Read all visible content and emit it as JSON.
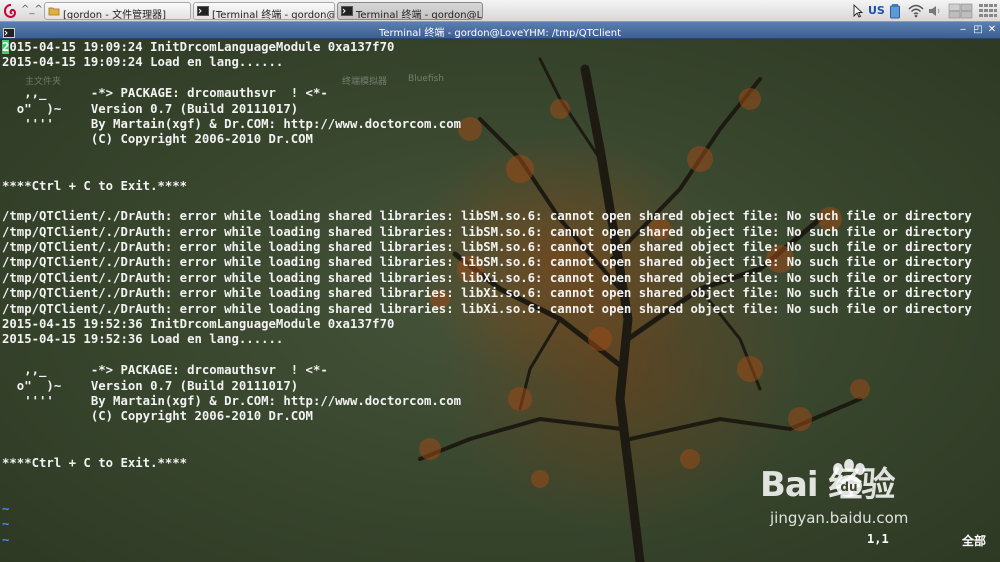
{
  "taskbar": {
    "small_label": "^_^",
    "tasks": [
      {
        "label": "[gordon - 文件管理器]",
        "icon": "folder-icon"
      },
      {
        "label": "[Terminal 终端 - gordon@L...",
        "icon": "terminal-icon"
      },
      {
        "label": "Terminal 终端 - gordon@Lo...",
        "icon": "terminal-icon"
      }
    ],
    "tray": {
      "keyboard_layout": "US",
      "icons": [
        "cursor-icon",
        "battery-icon",
        "wifi-icon",
        "volume-icon",
        "workspace-switcher-icon",
        "app-grid-icon"
      ]
    }
  },
  "window": {
    "title": "Terminal 终端 - gordon@LoveYHM: /tmp/QTClient",
    "buttons": [
      "minimize",
      "maximize",
      "close"
    ]
  },
  "terminal": {
    "lines": [
      "2015-04-15 19:09:24 InitDrcomLanguageModule 0xa137f70",
      "2015-04-15 19:09:24 Load en lang......",
      "",
      "   ,,_      -*> PACKAGE: drcomauthsvr  ! <*-",
      "  o\"  )~    Version 0.7 (Build 20111017)",
      "   ''''     By Martain(xgf) & Dr.COM: http://www.doctorcom.com",
      "            (C) Copyright 2006-2010 Dr.COM",
      "",
      "",
      "****Ctrl + C to Exit.****",
      "",
      "/tmp/QTClient/./DrAuth: error while loading shared libraries: libSM.so.6: cannot open shared object file: No such file or directory",
      "/tmp/QTClient/./DrAuth: error while loading shared libraries: libSM.so.6: cannot open shared object file: No such file or directory",
      "/tmp/QTClient/./DrAuth: error while loading shared libraries: libSM.so.6: cannot open shared object file: No such file or directory",
      "/tmp/QTClient/./DrAuth: error while loading shared libraries: libSM.so.6: cannot open shared object file: No such file or directory",
      "/tmp/QTClient/./DrAuth: error while loading shared libraries: libXi.so.6: cannot open shared object file: No such file or directory",
      "/tmp/QTClient/./DrAuth: error while loading shared libraries: libXi.so.6: cannot open shared object file: No such file or directory",
      "/tmp/QTClient/./DrAuth: error while loading shared libraries: libXi.so.6: cannot open shared object file: No such file or directory",
      "2015-04-15 19:52:36 InitDrcomLanguageModule 0xa137f70",
      "2015-04-15 19:52:36 Load en lang......",
      "",
      "   ,,_      -*> PACKAGE: drcomauthsvr  ! <*-",
      "  o\"  )~    Version 0.7 (Build 20111017)",
      "   ''''     By Martain(xgf) & Dr.COM: http://www.doctorcom.com",
      "            (C) Copyright 2006-2010 Dr.COM",
      "",
      "",
      "****Ctrl + C to Exit.****",
      "",
      "",
      "~",
      "~",
      "~"
    ],
    "cursor_char": "2",
    "status_position": "1,1",
    "status_scope": "全部"
  },
  "desktop_ghost_labels": [
    "主文件夹",
    "终端模拟器",
    "Bluefish"
  ],
  "watermark": {
    "brand": "Bai  经验",
    "url": "jingyan.baidu.com"
  },
  "colors": {
    "titlebar": "#4a6fa3",
    "text": "#f2f2f2",
    "cursor": "#3bd16f",
    "tilde": "#4f86ff"
  }
}
